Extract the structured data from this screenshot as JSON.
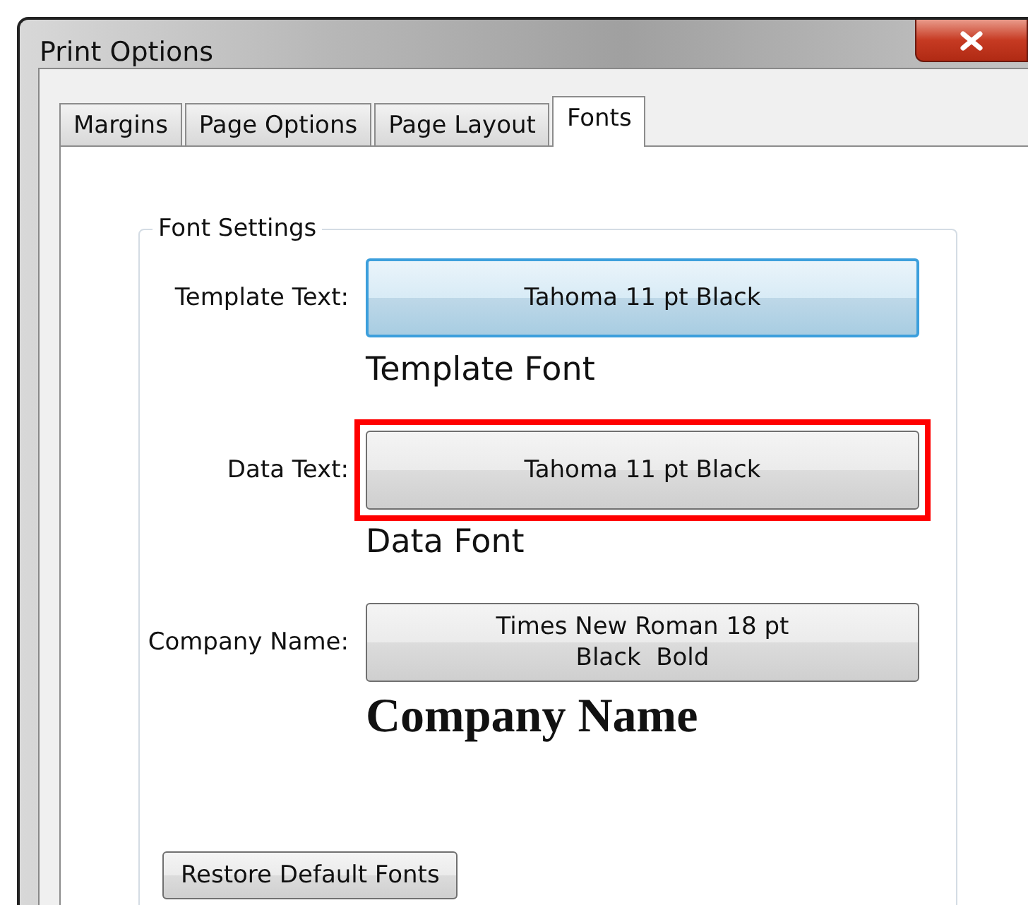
{
  "window": {
    "title": "Print Options"
  },
  "tabs": [
    {
      "label": "Margins",
      "selected": false
    },
    {
      "label": "Page Options",
      "selected": false
    },
    {
      "label": "Page Layout",
      "selected": false
    },
    {
      "label": "Fonts",
      "selected": true
    }
  ],
  "group": {
    "title": "Font Settings"
  },
  "rows": [
    {
      "label": "Template Text:",
      "button": "Tahoma 11 pt Black",
      "preview": "Template Font",
      "kind": "sans",
      "focused": true,
      "highlighted": false
    },
    {
      "label": "Data Text:",
      "button": "Tahoma 11 pt Black",
      "preview": "Data Font",
      "kind": "sans",
      "focused": false,
      "highlighted": true
    },
    {
      "label": "Company Name:",
      "button": "Times New Roman 18 pt\nBlack  Bold",
      "preview": "Company Name",
      "kind": "serif-bold",
      "focused": false,
      "highlighted": false
    }
  ],
  "restore_button": "Restore Default Fonts"
}
